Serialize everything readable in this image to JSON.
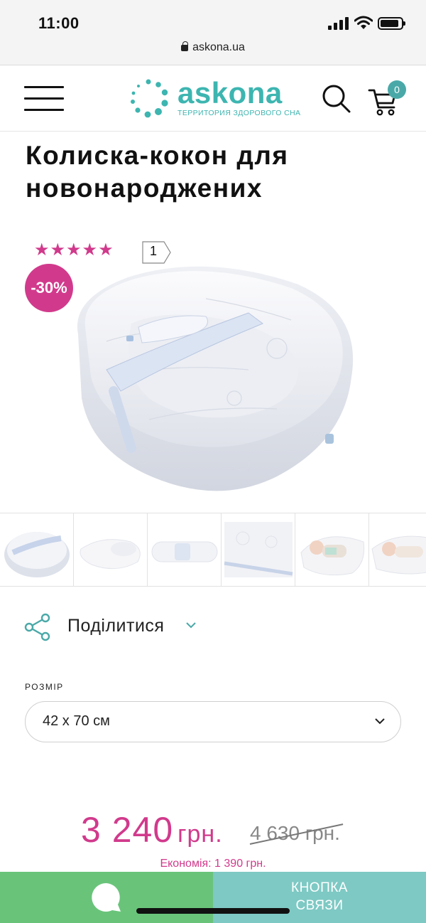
{
  "status_bar": {
    "time": "11:00",
    "url": "askona.ua",
    "battery_level": 0.9
  },
  "header": {
    "logo_text": "askona",
    "logo_tagline": "ТЕРРИТОРИЯ ЗДОРОВОГО СНА",
    "cart_count": "0",
    "icons": [
      "menu-icon",
      "search-icon",
      "cart-icon"
    ],
    "accent_color": "#3db5b0"
  },
  "product": {
    "title": "Колиска-кокон для новонароджених",
    "rating": 5,
    "stars": "★★★★★",
    "review_count": "1",
    "discount": "-30%",
    "thumbnail_count": 6
  },
  "share": {
    "label": "Поділитися"
  },
  "size": {
    "label": "РОЗМІР",
    "selected": "42 x 70 см"
  },
  "pricing": {
    "price": "3 240",
    "currency": "грн.",
    "old_price": "4 630",
    "old_currency": "грн.",
    "savings": "Економія: 1 390 грн.",
    "price_color": "#d13a8c"
  },
  "bottom_bar": {
    "contact_line1": "КНОПКА",
    "contact_line2": "СВЯЗИ",
    "chat_color": "#69c47a",
    "contact_color": "#7ec9c4"
  }
}
